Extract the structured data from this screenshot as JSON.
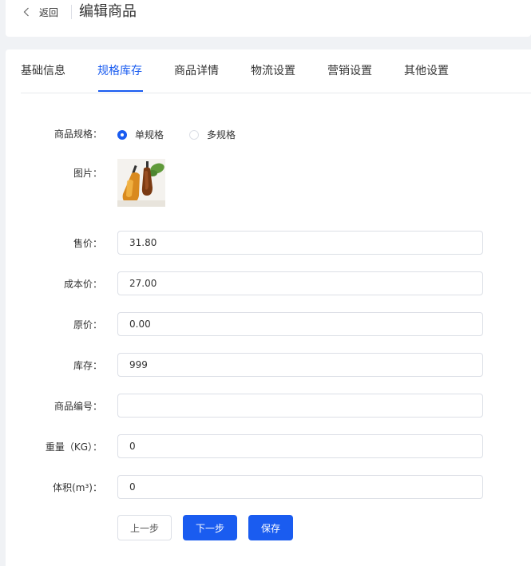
{
  "header": {
    "back_label": "返回",
    "title": "编辑商品"
  },
  "tabs": [
    {
      "label": "基础信息",
      "active": false
    },
    {
      "label": "规格库存",
      "active": true
    },
    {
      "label": "商品详情",
      "active": false
    },
    {
      "label": "物流设置",
      "active": false
    },
    {
      "label": "营销设置",
      "active": false
    },
    {
      "label": "其他设置",
      "active": false
    }
  ],
  "form": {
    "spec": {
      "label": "商品规格：",
      "options": [
        {
          "label": "单规格",
          "checked": true
        },
        {
          "label": "多规格",
          "checked": false
        }
      ]
    },
    "image": {
      "label": "图片："
    },
    "price": {
      "label": "售价：",
      "value": "31.80"
    },
    "cost_price": {
      "label": "成本价：",
      "value": "27.00"
    },
    "original_price": {
      "label": "原价：",
      "value": "0.00"
    },
    "stock": {
      "label": "库存：",
      "value": "999"
    },
    "product_code": {
      "label": "商品编号：",
      "value": ""
    },
    "weight": {
      "label": "重量（KG）：",
      "value": "0"
    },
    "volume": {
      "label": "体积(m³)：",
      "value": "0"
    }
  },
  "buttons": {
    "prev": "上一步",
    "next": "下一步",
    "save": "保存"
  },
  "colors": {
    "accent": "#1a5cf0",
    "border": "#dcdfe6",
    "background": "#f0f2f5"
  }
}
